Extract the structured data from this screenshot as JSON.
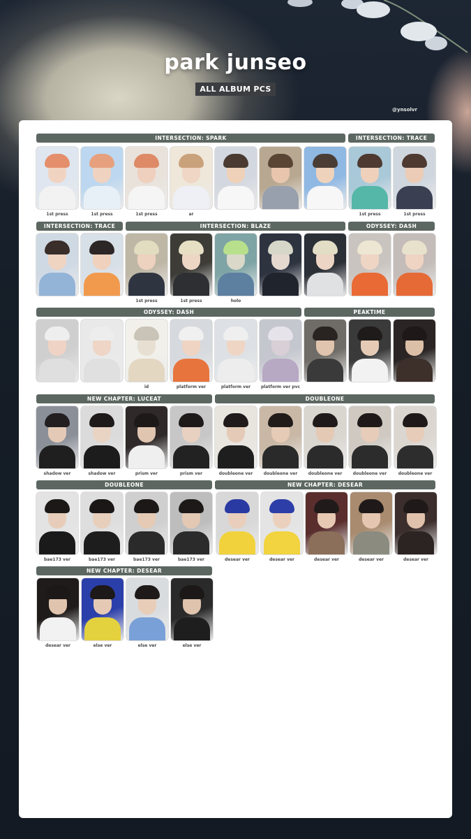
{
  "header": {
    "title": "park junseo",
    "subtitle": "ALL ALBUM PCS",
    "handle": "@ynsolvr"
  },
  "colors": {
    "background": "#151d27",
    "card": "#ffffff",
    "section_header": "#5d6762",
    "subtitle_box": "#3b3d41"
  },
  "sections": [
    {
      "title": "INTERSECTION: SPARK"
    },
    {
      "title": "INTERSECTION: TRACE"
    },
    {
      "title": "INTERSECTION: TRACE"
    },
    {
      "title": "INTERSECTION: BLAZE"
    },
    {
      "title": "ODYSSEY: DASH"
    },
    {
      "title": "ODYSSEY: DASH"
    },
    {
      "title": "PEAKTIME"
    },
    {
      "title": "NEW CHAPTER: LUCEAT"
    },
    {
      "title": "DOUBLEONE"
    },
    {
      "title": "DOUBLEONE"
    },
    {
      "title": "NEW CHAPTER: DESEAR"
    },
    {
      "title": "NEW CHAPTER: DESEAR"
    }
  ],
  "photocards": [
    {
      "label": "1st press",
      "palette": [
        "#dfe6ef",
        "#e58e6b",
        "#f1d3c2",
        "#f2f2f2"
      ]
    },
    {
      "label": "1st press",
      "palette": [
        "#bcd7ef",
        "#e7a07e",
        "#f0d2c1",
        "#e8f0f7"
      ]
    },
    {
      "label": "1st press",
      "palette": [
        "#e9e2db",
        "#de8a67",
        "#efcfbd",
        "#f5f5f5"
      ]
    },
    {
      "label": "ar",
      "palette": [
        "#efe7d9",
        "#c9a27c",
        "#efd6c5",
        "#eef0f6"
      ]
    },
    {
      "label": "",
      "palette": [
        "#d3d7df",
        "#4a3a32",
        "#efd0b8",
        "#f7f7f7"
      ]
    },
    {
      "label": "",
      "palette": [
        "#b8a891",
        "#5a4535",
        "#e8c6ad",
        "#98a0ad"
      ]
    },
    {
      "label": "",
      "palette": [
        "#8fb8e3",
        "#4a3d35",
        "#efd2bc",
        "#f7f7f7"
      ]
    },
    {
      "label": "1st press",
      "palette": [
        "#a9c8d8",
        "#4e3a30",
        "#efd0bb",
        "#54b7a7"
      ]
    },
    {
      "label": "1st press",
      "palette": [
        "#cfd6de",
        "#4e3a30",
        "#ecccb6",
        "#3b3f52"
      ]
    },
    {
      "label": "",
      "palette": [
        "#cfd9e4",
        "#3a2e2a",
        "#efd4c2",
        "#93b3d7"
      ]
    },
    {
      "label": "",
      "palette": [
        "#d7dfe7",
        "#2d2626",
        "#efd1bd",
        "#f19a4e"
      ]
    },
    {
      "label": "1st press",
      "palette": [
        "#bfb7a6",
        "#e2dcc0",
        "#ecd2bf",
        "#2f3540"
      ]
    },
    {
      "label": "1st press",
      "palette": [
        "#3d3c37",
        "#e6dfc4",
        "#eed6c4",
        "#2d2f33"
      ]
    },
    {
      "label": "holo",
      "palette": [
        "#7fa4a5",
        "#b8e08c",
        "#d9d8c9",
        "#5d7fa0"
      ]
    },
    {
      "label": "",
      "palette": [
        "#2e3340",
        "#d6d7c9",
        "#e4d8cf",
        "#20242c"
      ]
    },
    {
      "label": "",
      "palette": [
        "#2b2f36",
        "#e2ddc5",
        "#ecd5c4",
        "#dfe1e3"
      ]
    },
    {
      "label": "",
      "palette": [
        "#c9c4bf",
        "#ece6d2",
        "#efd5c4",
        "#e96a35"
      ]
    },
    {
      "label": "",
      "palette": [
        "#c3bcb8",
        "#e8e2cd",
        "#efd4c3",
        "#e56a36"
      ]
    },
    {
      "label": "",
      "palette": [
        "#cfcfcf",
        "#eeeeee",
        "#efd3c4",
        "#dfdfdf"
      ]
    },
    {
      "label": "",
      "palette": [
        "#e9e9e9",
        "#ededed",
        "#eed5c6",
        "#e0e0e0"
      ]
    },
    {
      "label": "id",
      "palette": [
        "#f1f0ea",
        "#c9c3b8",
        "#e8dfd3",
        "#e3d7c2"
      ]
    },
    {
      "label": "platform ver",
      "palette": [
        "#d6d9dd",
        "#f0f0f0",
        "#efd4c3",
        "#e8743d"
      ]
    },
    {
      "label": "platform ver",
      "palette": [
        "#dde1e5",
        "#efefef",
        "#efd5c4",
        "#ededed"
      ]
    },
    {
      "label": "platform ver pvc",
      "palette": [
        "#c5c7cf",
        "#e6e3ea",
        "#d9cfd6",
        "#b7a8c4"
      ]
    },
    {
      "label": "",
      "palette": [
        "#6f6b66",
        "#292321",
        "#e0c4ad",
        "#3a3a3a"
      ]
    },
    {
      "label": "",
      "palette": [
        "#3a3a3a",
        "#1f1b1a",
        "#e5cbb6",
        "#f2f2f2"
      ]
    },
    {
      "label": "",
      "palette": [
        "#2a2524",
        "#1e1918",
        "#dcbfa7",
        "#3d2f2a"
      ]
    },
    {
      "label": "shadow ver",
      "palette": [
        "#8b8f98",
        "#231f20",
        "#e4cab6",
        "#1f1f1f"
      ]
    },
    {
      "label": "shadow ver",
      "palette": [
        "#dbdbdb",
        "#1e1a1a",
        "#e9d3c3",
        "#1c1c1c"
      ]
    },
    {
      "label": "prism ver",
      "palette": [
        "#2f2a29",
        "#1d1918",
        "#e0c5b1",
        "#efefef"
      ]
    },
    {
      "label": "prism ver",
      "palette": [
        "#c7c7c7",
        "#1e1a1a",
        "#e8d1c1",
        "#222222"
      ]
    },
    {
      "label": "doubleone ver",
      "palette": [
        "#e8e4de",
        "#201b1a",
        "#e5cbb7",
        "#1e1e1e"
      ]
    },
    {
      "label": "doubleone ver",
      "palette": [
        "#c9b8a6",
        "#211c1a",
        "#e6cbb6",
        "#2a2a2a"
      ]
    },
    {
      "label": "doubleone ver",
      "palette": [
        "#d9d5cf",
        "#201b1a",
        "#e4c9b4",
        "#2b2b2b"
      ]
    },
    {
      "label": "doubleone ver",
      "palette": [
        "#cfc9c2",
        "#1f1a19",
        "#e6ccb9",
        "#2c2c2c"
      ]
    },
    {
      "label": "doubleone ver",
      "palette": [
        "#dbd6d0",
        "#1f1a19",
        "#e6ccb9",
        "#2d2d2d"
      ]
    },
    {
      "label": "bae173 ver",
      "palette": [
        "#e3e3e3",
        "#1c1818",
        "#e7cdb9",
        "#1a1a1a"
      ]
    },
    {
      "label": "bae173 ver",
      "palette": [
        "#dedede",
        "#1b1717",
        "#e8cfbb",
        "#1d1d1d"
      ]
    },
    {
      "label": "bae173 ver",
      "palette": [
        "#cfcfcf",
        "#1c1818",
        "#e5cab5",
        "#2a2a2a"
      ]
    },
    {
      "label": "bae173 ver",
      "palette": [
        "#bdbdbd",
        "#1d1919",
        "#e3c8b3",
        "#2b2b2b"
      ]
    },
    {
      "label": "desear ver",
      "palette": [
        "#d8d8d8",
        "#2a3aa3",
        "#e9cfbb",
        "#f1d23c"
      ]
    },
    {
      "label": "desear ver",
      "palette": [
        "#e4e4e4",
        "#2d3ea8",
        "#ebd1bd",
        "#f2d340"
      ]
    },
    {
      "label": "desear ver",
      "palette": [
        "#5b2e2e",
        "#201b1a",
        "#e7c9b3",
        "#8b6f5a"
      ]
    },
    {
      "label": "desear ver",
      "palette": [
        "#a98b6f",
        "#1f1a19",
        "#e5c7b1",
        "#8b8b80"
      ]
    },
    {
      "label": "desear ver",
      "palette": [
        "#3b2e2c",
        "#1f1a19",
        "#e0c2ac",
        "#2b2422"
      ]
    },
    {
      "label": "desear ver",
      "palette": [
        "#1f1b1a",
        "#1c1818",
        "#e1c4ae",
        "#f2f2f2"
      ]
    },
    {
      "label": "else ver",
      "palette": [
        "#2b3faa",
        "#1d1919",
        "#e5c9b4",
        "#e4d13e"
      ]
    },
    {
      "label": "else ver",
      "palette": [
        "#d9dcdf",
        "#1e1a1a",
        "#e8cdb9",
        "#7aa0d8"
      ]
    },
    {
      "label": "else ver",
      "palette": [
        "#2a2a2a",
        "#1c1818",
        "#dfc3ad",
        "#1e1e1e"
      ]
    }
  ]
}
